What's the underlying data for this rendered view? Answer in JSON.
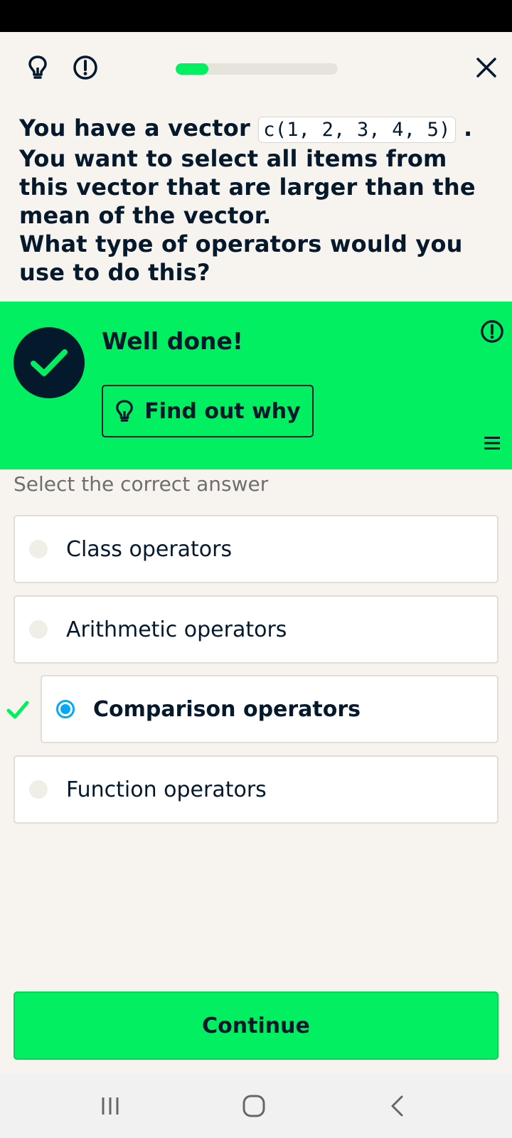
{
  "quiz": {
    "progress_fraction": 0.2,
    "question_part1": "You have a vector",
    "code": "c(1, 2, 3, 4, 5)",
    "question_part1_end": ".",
    "question_line2": "You want to select all items from this vector that are larger than the mean of the vector.",
    "question_line3": "What type of operators would you use to do this?"
  },
  "feedback": {
    "title": "Well done!",
    "why_button": "Find out why"
  },
  "answers": {
    "prompt": "Select the correct answer",
    "options": [
      {
        "label": "Class operators",
        "selected": false
      },
      {
        "label": "Arithmetic operators",
        "selected": false
      },
      {
        "label": "Comparison operators",
        "selected": true
      },
      {
        "label": "Function operators",
        "selected": false
      }
    ]
  },
  "footer": {
    "continue_label": "Continue"
  },
  "icons": {
    "hint": "lightbulb-icon",
    "report": "report-icon",
    "close": "close-icon",
    "correct": "checkmark-icon",
    "menu": "menu-icon"
  },
  "colors": {
    "accent_green": "#03EF62",
    "navy": "#05192D",
    "selected_blue": "#03A9F4",
    "background": "#F7F3EE"
  }
}
